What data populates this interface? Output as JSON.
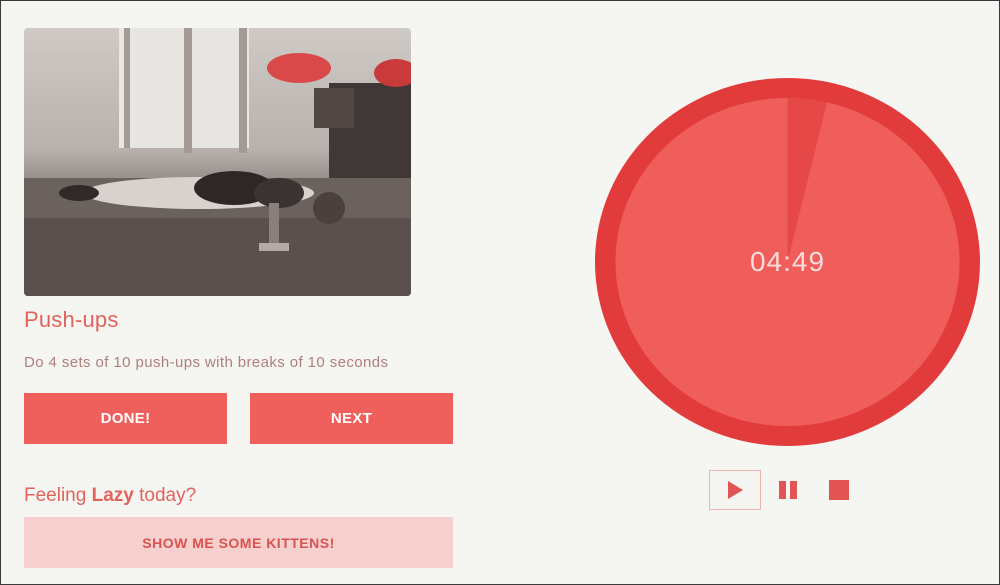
{
  "exercise": {
    "image_alt": "woman doing push-ups on floor",
    "title": "Push-ups",
    "description": "Do 4 sets of 10 push-ups with breaks of 10 seconds"
  },
  "actions": {
    "done_label": "DONE!",
    "next_label": "NEXT"
  },
  "lazy": {
    "prefix": "Feeling ",
    "emphasis": "Lazy",
    "suffix": " today?",
    "button_label": "SHOW ME SOME KITTENS!"
  },
  "timer": {
    "display": "04:49",
    "elapsed_fraction": 0.037,
    "colors": {
      "ring": "#e23b3b",
      "face": "#f05e5b",
      "elapsed": "#e64848",
      "text": "#f8dcdc"
    }
  },
  "controls": {
    "play_icon": "play-icon",
    "pause_icon": "pause-icon",
    "stop_icon": "stop-icon",
    "color": "#e25454"
  },
  "colors": {
    "accent": "#ef5f5b",
    "accent_text": "#e2625c",
    "kittens_bg": "#f6cfcf",
    "background": "#f5f5f2"
  }
}
